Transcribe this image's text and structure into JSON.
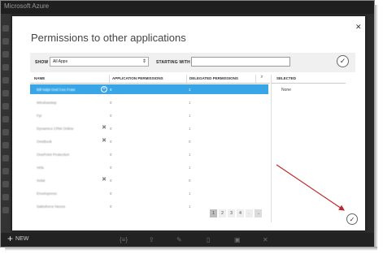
{
  "portal": {
    "title": "Microsoft Azure",
    "new_label": "NEW"
  },
  "dialog": {
    "title": "Permissions to other applications"
  },
  "filter": {
    "show_label": "SHOW",
    "show_value": "All Apps",
    "starting_with_label": "STARTING WITH",
    "starting_with_value": ""
  },
  "table": {
    "columns": [
      "NAME",
      "APPLICATION PERMISSIONS",
      "DELEGATED PERMISSIONS"
    ],
    "rows": [
      {
        "name": "Bill Ndpt Gnd Ces Frate",
        "app": "0",
        "del": "1",
        "icon": "plus-circle",
        "selected": true
      },
      {
        "name": "Windowstep",
        "app": "0",
        "del": "1",
        "icon": "",
        "selected": false
      },
      {
        "name": "Fpi",
        "app": "0",
        "del": "1",
        "icon": "",
        "selected": false
      },
      {
        "name": "Dynamics CRM Online",
        "app": "0",
        "del": "1",
        "icon": "x",
        "selected": false
      },
      {
        "name": "OneBook",
        "app": "0",
        "del": "0",
        "icon": "x",
        "selected": false
      },
      {
        "name": "OnePoint Protection",
        "app": "0",
        "del": "1",
        "icon": "",
        "selected": false
      },
      {
        "name": "Vela",
        "app": "0",
        "del": "1",
        "icon": "",
        "selected": false
      },
      {
        "name": "Xelat",
        "app": "0",
        "del": "0",
        "icon": "x",
        "selected": false
      },
      {
        "name": "Envelopress",
        "app": "0",
        "del": "1",
        "icon": "",
        "selected": false
      },
      {
        "name": "Salesforce Nexus",
        "app": "0",
        "del": "1",
        "icon": "",
        "selected": false
      }
    ]
  },
  "selected_panel": {
    "heading": "SELECTED",
    "value": "None"
  },
  "pager": {
    "pages": [
      "1",
      "2",
      "3",
      "4"
    ],
    "prev": "←",
    "next": "→",
    "current": "1"
  },
  "colors": {
    "selected_row": "#38a6e6",
    "annotation_arrow": "#c0272d"
  }
}
